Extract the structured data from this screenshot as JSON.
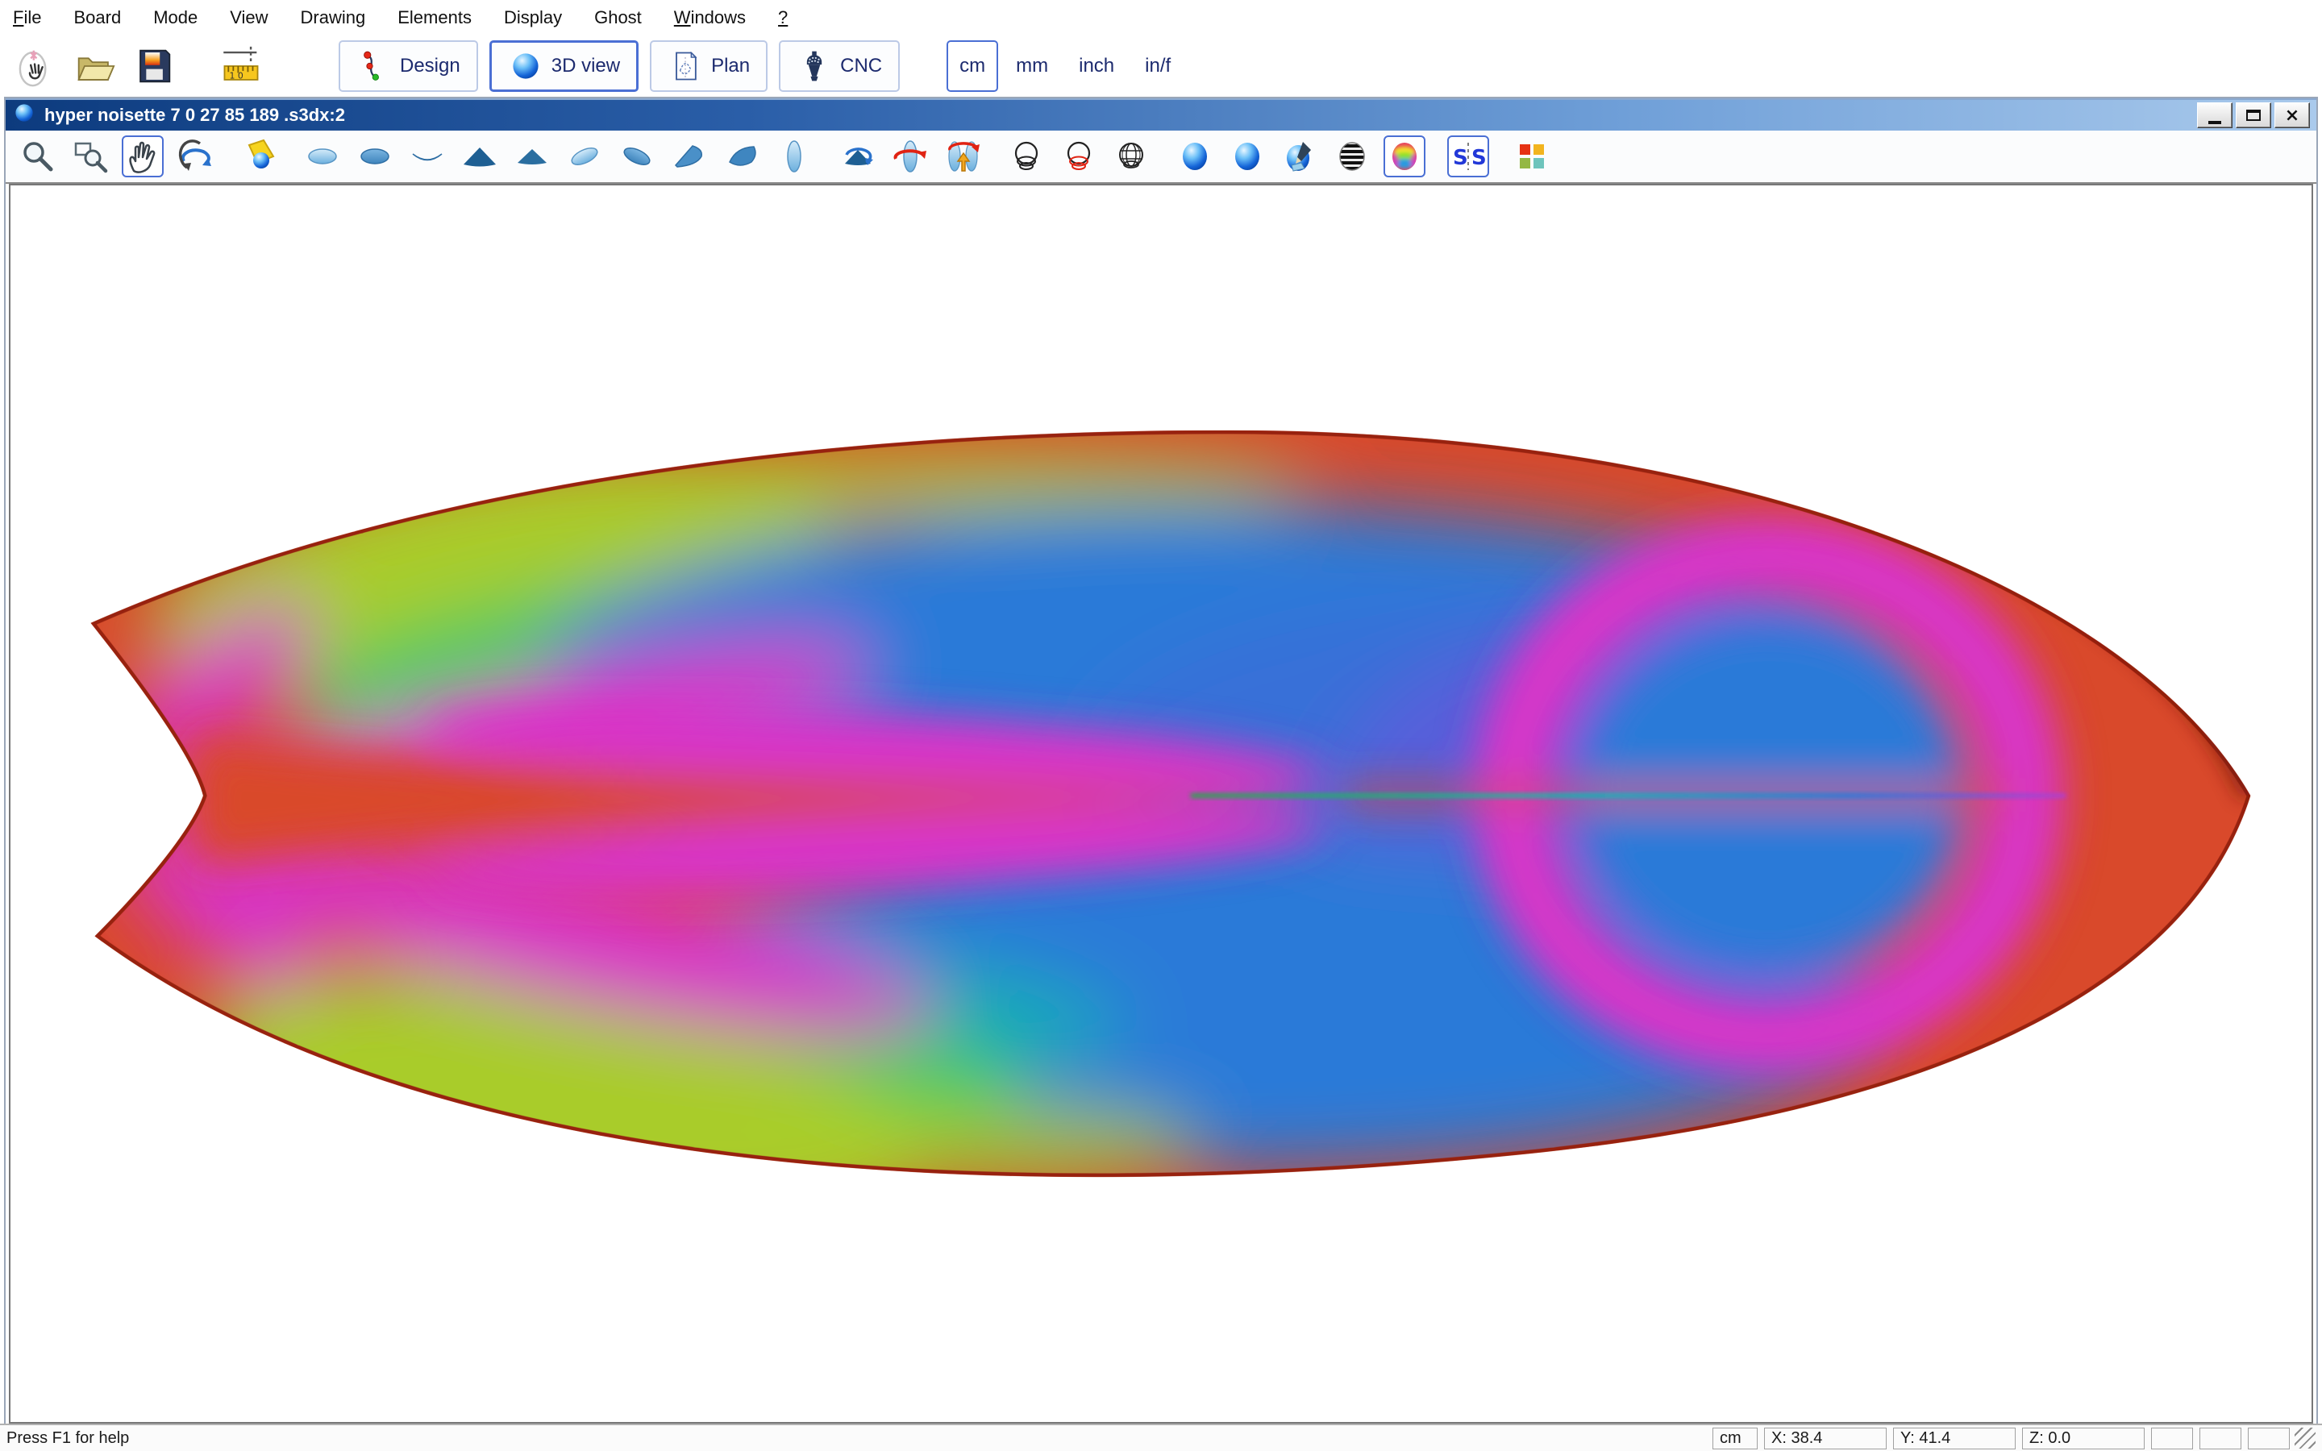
{
  "menu": {
    "items": [
      {
        "label": "File",
        "underlined": true
      },
      {
        "label": "Board",
        "underlined": false
      },
      {
        "label": "Mode",
        "underlined": false
      },
      {
        "label": "View",
        "underlined": false
      },
      {
        "label": "Drawing",
        "underlined": false
      },
      {
        "label": "Elements",
        "underlined": false
      },
      {
        "label": "Display",
        "underlined": false
      },
      {
        "label": "Ghost",
        "underlined": false
      },
      {
        "label": "Windows",
        "underlined": true
      },
      {
        "label": "?",
        "underlined": true
      }
    ]
  },
  "toolbar_main": {
    "file_icons": [
      "new-board-icon",
      "open-folder-icon",
      "save-icon",
      "measure-icon"
    ],
    "mode_buttons": [
      {
        "label": "Design",
        "icon": "design-nodes-icon",
        "selected": false
      },
      {
        "label": "3D view",
        "icon": "sphere-icon",
        "selected": true
      },
      {
        "label": "Plan",
        "icon": "plan-doc-icon",
        "selected": false
      },
      {
        "label": "CNC",
        "icon": "cnc-bit-icon",
        "selected": false
      }
    ],
    "units": [
      {
        "label": "cm",
        "selected": true
      },
      {
        "label": "mm",
        "selected": false
      },
      {
        "label": "inch",
        "selected": false
      },
      {
        "label": "in/f",
        "selected": false
      }
    ]
  },
  "window": {
    "title": "hyper noisette 7 0 27 85 189 .s3dx:2",
    "icon": "sphere-icon",
    "controls": [
      "minimize",
      "maximize",
      "close"
    ]
  },
  "toolbar_view": {
    "icons": [
      {
        "name": "zoom-icon",
        "group": "zoom",
        "selected": false
      },
      {
        "name": "zoom-window-icon",
        "group": "zoom",
        "selected": false
      },
      {
        "name": "pan-hand-icon",
        "group": "zoom",
        "selected": true
      },
      {
        "name": "rotate-3d-icon",
        "group": "zoom",
        "selected": false
      },
      {
        "name": "light-icon",
        "group": "light",
        "selected": false
      },
      {
        "name": "view-top-icon",
        "group": "views",
        "selected": false
      },
      {
        "name": "view-bottom-icon",
        "group": "views",
        "selected": false
      },
      {
        "name": "view-rocker-icon",
        "group": "views",
        "selected": false
      },
      {
        "name": "view-front-icon",
        "group": "views",
        "selected": false
      },
      {
        "name": "view-back-icon",
        "group": "views",
        "selected": false
      },
      {
        "name": "view-perspective-top-icon",
        "group": "views",
        "selected": false
      },
      {
        "name": "view-perspective-bottom-icon",
        "group": "views",
        "selected": false
      },
      {
        "name": "view-angled-top-icon",
        "group": "views",
        "selected": false
      },
      {
        "name": "view-angled-bottom-icon",
        "group": "views",
        "selected": false
      },
      {
        "name": "view-outline-icon",
        "group": "views",
        "selected": false
      },
      {
        "name": "auto-rotate-icon",
        "group": "rotate",
        "selected": false
      },
      {
        "name": "rotate-board-icon",
        "group": "rotate",
        "selected": false
      },
      {
        "name": "flip-board-icon",
        "group": "rotate",
        "selected": false
      },
      {
        "name": "wireframe-icon",
        "group": "wire",
        "selected": false
      },
      {
        "name": "wireframe-sections-icon",
        "group": "wire",
        "selected": false
      },
      {
        "name": "mesh-icon",
        "group": "wire",
        "selected": false
      },
      {
        "name": "render-solid-icon",
        "group": "render",
        "selected": false
      },
      {
        "name": "render-smooth-icon",
        "group": "render",
        "selected": false
      },
      {
        "name": "render-paint-icon",
        "group": "render",
        "selected": false
      },
      {
        "name": "render-stripes-icon",
        "group": "render",
        "selected": false
      },
      {
        "name": "render-curvature-icon",
        "group": "render",
        "selected": true
      },
      {
        "name": "symmetry-icon",
        "group": "symmetry",
        "selected": true
      },
      {
        "name": "palette-icon",
        "group": "palette",
        "selected": false
      }
    ]
  },
  "statusbar": {
    "help_text": "Press F1 for help",
    "cells": [
      {
        "label": "cm",
        "width": 56
      },
      {
        "label": "X: 38.4",
        "width": 152
      },
      {
        "label": "Y: 41.4",
        "width": 152
      },
      {
        "label": "Z: 0.0",
        "width": 152
      },
      {
        "label": "",
        "width": 52
      },
      {
        "label": "",
        "width": 52
      },
      {
        "label": "",
        "width": 52
      }
    ]
  },
  "board": {
    "view_mode": "curvature-map",
    "colors": {
      "base": "#D9492B",
      "rail_edge": "#97220F",
      "nose_shadow": "#7E1C0C",
      "chartreuse": "#A9CC2A",
      "green": "#2ECC63",
      "teal": "#12B8B0",
      "blue": "#2B7AD8",
      "deep_blue": "#3F6AD8",
      "violet": "#7A50DC",
      "magenta": "#D836C8"
    }
  }
}
